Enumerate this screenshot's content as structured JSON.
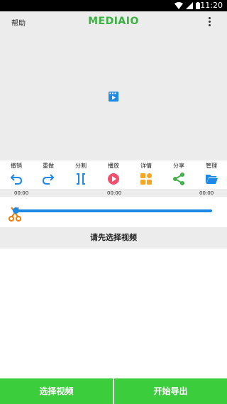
{
  "status_bar": {
    "time": "11:20",
    "icons": [
      "wifi-icon",
      "signal-icon",
      "battery-icon"
    ]
  },
  "appbar": {
    "help": "帮助",
    "logo": "MEDIAIO",
    "menu_icon": "more-vert-icon"
  },
  "preview": {
    "icon": "video-file-icon"
  },
  "toolbar": {
    "items": [
      {
        "label": "撤销",
        "icon": "undo-icon",
        "color": "#1e88e5"
      },
      {
        "label": "重做",
        "icon": "redo-icon",
        "color": "#1e88e5"
      },
      {
        "label": "分割",
        "icon": "split-icon",
        "color": "#1e88e5"
      },
      {
        "label": "播放",
        "icon": "play-icon",
        "color": "#f0506e"
      },
      {
        "label": "详情",
        "icon": "details-grid-icon",
        "color": "#f5a623"
      },
      {
        "label": "分享",
        "icon": "share-icon",
        "color": "#43b04a"
      },
      {
        "label": "管理",
        "icon": "folder-icon",
        "color": "#1e88e5"
      }
    ]
  },
  "timeline": {
    "start": "00:00",
    "current": "00:00",
    "end": "00:00"
  },
  "hint": "请先选择视频",
  "buttons": {
    "select_video": "选择视频",
    "export": "开始导出"
  },
  "colors": {
    "brand_green": "#3cb043",
    "button_green": "#3ccd3c",
    "accent_blue": "#1e88e5"
  }
}
